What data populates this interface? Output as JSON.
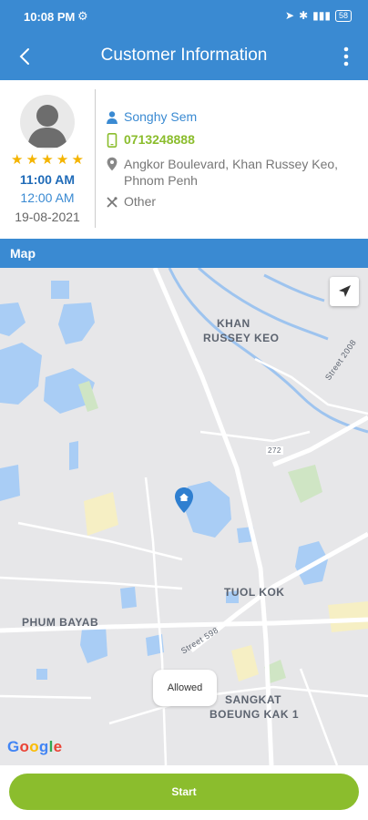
{
  "status_bar": {
    "time": "10:08 PM",
    "battery": "58"
  },
  "app_bar": {
    "title": "Customer Information"
  },
  "customer": {
    "rating": 5,
    "time_primary": "11:00 AM",
    "time_secondary": "12:00 AM",
    "date": "19-08-2021",
    "name": "Songhy Sem",
    "phone": "0713248888",
    "address": "Angkor Boulevard, Khan Russey Keo, Phnom Penh",
    "category": "Other"
  },
  "map": {
    "header": "Map",
    "labels": {
      "khan": "KHAN",
      "russey_keo": "RUSSEY KEO",
      "tuol_kok": "TUOL KOK",
      "phum_bayab": "PHUM BAYAB",
      "sangkat": "SANGKAT",
      "boeung_kak": "BOEUNG KAK 1",
      "street_598": "Street 598",
      "street_2008": "Street 2008",
      "route_272": "272"
    },
    "toast": "Allowed",
    "google_brand": "Google"
  },
  "actions": {
    "start_label": "Start"
  },
  "colors": {
    "primary": "#3a8ad2",
    "accent_green": "#8bbd2d",
    "star": "#f4b400"
  }
}
